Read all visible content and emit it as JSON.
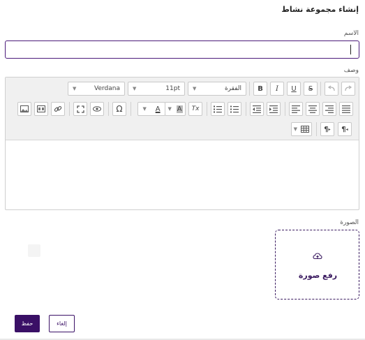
{
  "dialog": {
    "title": "إنشاء مجموعة نشاط"
  },
  "form": {
    "name_label": "الاسم",
    "name_value": "",
    "description_label": "وصف",
    "image_label": "الصورة",
    "upload_label": "رفع صورة"
  },
  "toolbar": {
    "paragraph_value": "الفقرة",
    "font_size_value": "11pt",
    "font_family_value": "Verdana",
    "bold_label": "B",
    "italic_label": "I",
    "underline_label": "U",
    "strikethrough_label": "S",
    "omega_label": "Ω",
    "text_color_label": "A",
    "highlight_label": "A",
    "clear_format_label": "Tx",
    "ltr_label": "¶",
    "rtl_label": "¶"
  },
  "actions": {
    "save_label": "حفظ",
    "cancel_label": "إلغاء"
  },
  "colors": {
    "accent": "#3a1066",
    "focus_border": "#4b1a7a"
  }
}
